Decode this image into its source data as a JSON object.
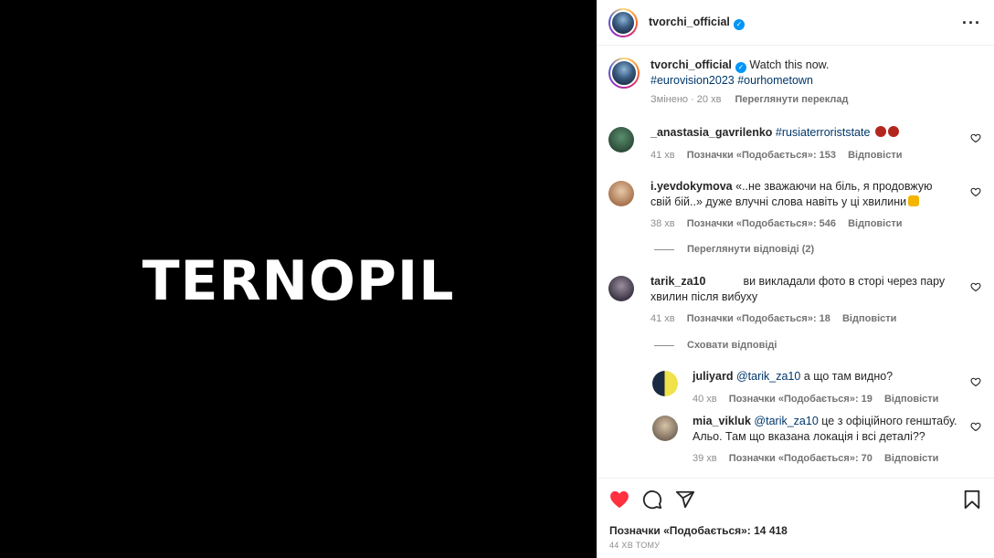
{
  "media": {
    "text": "TERNOPIL"
  },
  "header": {
    "username": "tvorchi_official",
    "verified_mark": "✓",
    "more_label": "···"
  },
  "caption": {
    "username": "tvorchi_official",
    "text": "Watch this now.",
    "hashtags": "#eurovision2023 #ourhometown",
    "edited": "Змінено · 20 хв",
    "translate": "Переглянути переклад"
  },
  "comments": [
    {
      "username": "_anastasia_gavrilenko",
      "text": "#rusiaterroriststate",
      "time": "41 хв",
      "likes": "Позначки «Подобається»: 153",
      "reply": "Відповісти"
    },
    {
      "username": "i.yevdokymova",
      "text": "«..не зважаючи на біль, я продовжую свій бій..» дуже влучні слова навіть у ці хвилини",
      "time": "38 хв",
      "likes": "Позначки «Подобається»: 546",
      "reply": "Відповісти",
      "toggle": "Переглянути відповіді (2)"
    },
    {
      "username": "tarik_za10",
      "text": "ви викладали фото в сторі через пару хвилин після вибуху",
      "time": "41 хв",
      "likes": "Позначки «Подобається»: 18",
      "reply": "Відповісти",
      "toggle": "Сховати відповіді"
    }
  ],
  "replies": [
    {
      "username": "juliyard",
      "mention": "@tarik_za10",
      "text": "а що там видно?",
      "time": "40 хв",
      "likes": "Позначки «Подобається»: 19",
      "reply": "Відповісти"
    },
    {
      "username": "mia_vikluk",
      "mention": "@tarik_za10",
      "text": "це з офіційного генштабу. Альо. Там що вказана локація і всі деталі??",
      "time": "39 хв",
      "likes": "Позначки «Подобається»: 70",
      "reply": "Відповісти"
    }
  ],
  "footer": {
    "likes": "Позначки «Подобається»: 14 418",
    "time_ago": "44 ХВ ТОМУ"
  },
  "icons": {
    "like": "heart-filled-icon",
    "comment": "comment-icon",
    "share": "share-icon",
    "save": "bookmark-icon",
    "comment_like": "heart-outline-icon"
  },
  "colors": {
    "like_red": "#ff3040",
    "link_blue": "#00376b",
    "verified_blue": "#0095f6"
  }
}
